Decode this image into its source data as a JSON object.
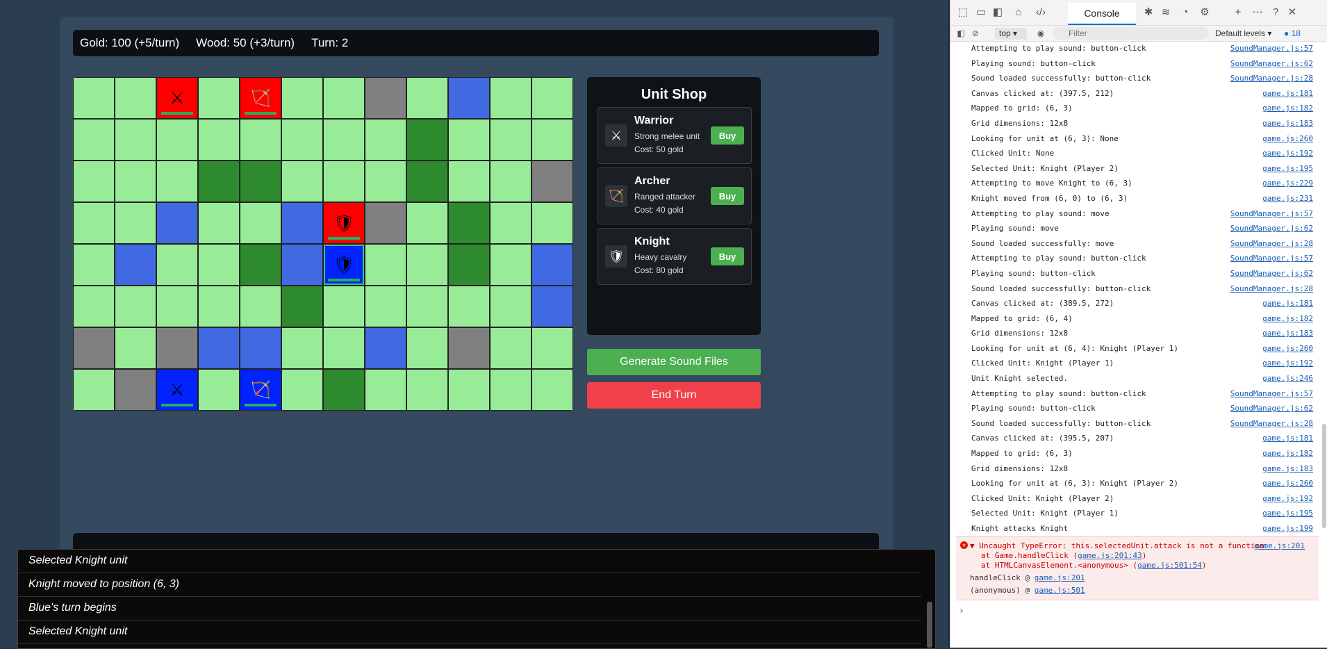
{
  "stats": {
    "gold": "Gold: 100 (+5/turn)",
    "wood": "Wood: 50 (+3/turn)",
    "turn": "Turn: 2"
  },
  "board": {
    "rows": [
      [
        "g",
        "g",
        {
          "t": "r",
          "u": "warrior"
        },
        "g",
        {
          "t": "r",
          "u": "archer"
        },
        "g",
        "g",
        "s",
        "g",
        "w",
        "g",
        "g"
      ],
      [
        "g",
        "g",
        "g",
        "g",
        "g",
        "g",
        "g",
        "g",
        "d",
        "g",
        "g",
        "g"
      ],
      [
        "g",
        "g",
        "g",
        "d",
        "d",
        "g",
        "g",
        "g",
        "d",
        "g",
        "g",
        "s"
      ],
      [
        "g",
        "g",
        "w",
        "g",
        "g",
        "w",
        {
          "t": "r",
          "u": "knight"
        },
        "s",
        "g",
        "d",
        "g",
        "g"
      ],
      [
        "g",
        "w",
        "g",
        "g",
        "d",
        "w",
        {
          "t": "b",
          "u": "knight",
          "sel": true
        },
        "g",
        "g",
        "d",
        "g",
        "w"
      ],
      [
        "g",
        "g",
        "g",
        "g",
        "g",
        "d",
        "g",
        "g",
        "g",
        "g",
        "g",
        "w"
      ],
      [
        "s",
        "g",
        "s",
        "w",
        "w",
        "g",
        "g",
        "w",
        "g",
        "s",
        "g",
        "g"
      ],
      [
        "g",
        "s",
        {
          "t": "b",
          "u": "warrior"
        },
        "g",
        {
          "t": "b",
          "u": "archer"
        },
        "g",
        "d",
        "g",
        "g",
        "g",
        "g",
        "g"
      ]
    ],
    "tile_colors": {
      "g": "#98ec98",
      "d": "#2e8a2e",
      "w": "#4169e1",
      "s": "#808080",
      "r": "#ff0000",
      "b": "#0022ff"
    },
    "unit_glyphs": {
      "warrior": "⚔",
      "archer": "🏹",
      "knight": "🛡"
    }
  },
  "shop": {
    "title": "Unit Shop",
    "items": [
      {
        "name": "Warrior",
        "desc": "Strong melee unit",
        "cost": "Cost: 50 gold",
        "buy": "Buy",
        "glyph": "⚔"
      },
      {
        "name": "Archer",
        "desc": "Ranged attacker",
        "cost": "Cost: 40 gold",
        "buy": "Buy",
        "glyph": "🏹"
      },
      {
        "name": "Knight",
        "desc": "Heavy cavalry",
        "cost": "Cost: 80 gold",
        "buy": "Buy",
        "glyph": "🛡"
      }
    ]
  },
  "buttons": {
    "generate": "Generate Sound Files",
    "end_turn": "End Turn"
  },
  "log": [
    "Selected Knight unit",
    "Knight moved to position (6, 3)",
    "Blue's turn begins",
    "Selected Knight unit"
  ],
  "devtools": {
    "tab": "Console",
    "context": "top",
    "filter_placeholder": "Filter",
    "levels": "Default levels",
    "issues": "18",
    "messages": [
      [
        "Attempting to play sound: button-click",
        "SoundManager.js:57"
      ],
      [
        "Playing sound: button-click",
        "SoundManager.js:62"
      ],
      [
        "Sound loaded successfully: button-click",
        "SoundManager.js:28"
      ],
      [
        "Canvas clicked at: (397.5, 212)",
        "game.js:181"
      ],
      [
        "Mapped to grid: (6, 3)",
        "game.js:182"
      ],
      [
        "Grid dimensions: 12x8",
        "game.js:183"
      ],
      [
        "Looking for unit at (6, 3): None",
        "game.js:260"
      ],
      [
        "Clicked Unit: None",
        "game.js:192"
      ],
      [
        "Selected Unit: Knight (Player 2)",
        "game.js:195"
      ],
      [
        "Attempting to move Knight to (6, 3)",
        "game.js:229"
      ],
      [
        "Knight moved from (6, 0) to (6, 3)",
        "game.js:231"
      ],
      [
        "Attempting to play sound: move",
        "SoundManager.js:57"
      ],
      [
        "Playing sound: move",
        "SoundManager.js:62"
      ],
      [
        "Sound loaded successfully: move",
        "SoundManager.js:28"
      ],
      [
        "Attempting to play sound: button-click",
        "SoundManager.js:57"
      ],
      [
        "Playing sound: button-click",
        "SoundManager.js:62"
      ],
      [
        "Sound loaded successfully: button-click",
        "SoundManager.js:28"
      ],
      [
        "Canvas clicked at: (389.5, 272)",
        "game.js:181"
      ],
      [
        "Mapped to grid: (6, 4)",
        "game.js:182"
      ],
      [
        "Grid dimensions: 12x8",
        "game.js:183"
      ],
      [
        "Looking for unit at (6, 4): Knight (Player 1)",
        "game.js:260"
      ],
      [
        "Clicked Unit: Knight (Player 1)",
        "game.js:192"
      ],
      [
        "Unit Knight selected.",
        "game.js:246"
      ],
      [
        "Attempting to play sound: button-click",
        "SoundManager.js:57"
      ],
      [
        "Playing sound: button-click",
        "SoundManager.js:62"
      ],
      [
        "Sound loaded successfully: button-click",
        "SoundManager.js:28"
      ],
      [
        "Canvas clicked at: (395.5, 207)",
        "game.js:181"
      ],
      [
        "Mapped to grid: (6, 3)",
        "game.js:182"
      ],
      [
        "Grid dimensions: 12x8",
        "game.js:183"
      ],
      [
        "Looking for unit at (6, 3): Knight (Player 2)",
        "game.js:260"
      ],
      [
        "Clicked Unit: Knight (Player 2)",
        "game.js:192"
      ],
      [
        "Selected Unit: Knight (Player 1)",
        "game.js:195"
      ],
      [
        "Knight attacks Knight",
        "game.js:199"
      ]
    ],
    "error": {
      "text": "▼ Uncaught TypeError: this.selectedUnit.attack is not a function",
      "src": "game.js:201",
      "stack1_pre": "at Game.handleClick (",
      "stack1_link": "game.js:201:43",
      "stack1_post": ")",
      "stack2_pre": "at HTMLCanvasElement.<anonymous> (",
      "stack2_link": "game.js:501:54",
      "stack2_post": ")",
      "trace1_label": "handleClick @ ",
      "trace1_link": "game.js:201",
      "trace2_label": "(anonymous) @ ",
      "trace2_link": "game.js:501"
    },
    "prompt": "›"
  }
}
